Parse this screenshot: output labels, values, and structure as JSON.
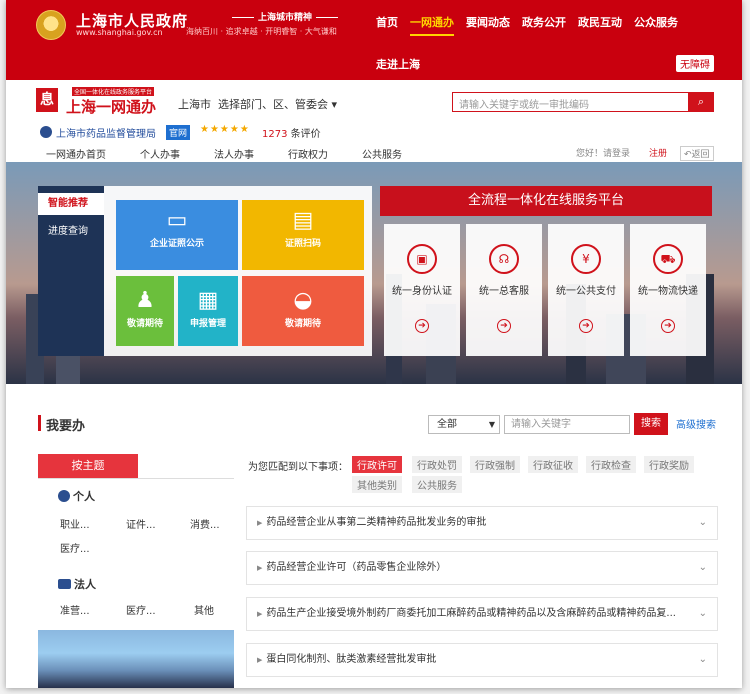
{
  "gov": {
    "title": "上海市人民政府",
    "url": "www.shanghai.gov.cn",
    "slogan_top": "上海城市精神",
    "slogan": "海纳百川 · 追求卓越 · 开明睿智 · 大气谦和",
    "nav": [
      "首页",
      "一网通办",
      "要闻动态",
      "政务公开",
      "政民互动",
      "公众服务"
    ],
    "nav_active": "一网通办",
    "nav2": "走进上海",
    "accessibility": "无障碍"
  },
  "ywtb": {
    "logo_mark": "息",
    "sub": "全国一体化在线政务服务平台",
    "title": "上海一网通办",
    "city": "上海市",
    "dept_select": "选择部门、区、管委会",
    "search_placeholder": "请输入关键字或统一审批编码",
    "agency": "上海市药品监督管理局",
    "official": "官网",
    "stars": "★★★★★",
    "rating_count": "1273",
    "rating_suffix": "条评价",
    "nav": [
      "一网通办首页",
      "个人办事",
      "法人办事",
      "行政权力",
      "公共服务"
    ],
    "login": "您好！请登录",
    "register": "注册",
    "back": "返回"
  },
  "banner": {
    "tab_active": "智能推荐",
    "tab_other": "进度查询",
    "tiles": [
      "企业证照公示",
      "证照扫码",
      "敬请期待",
      "申报管理",
      "敬请期待"
    ],
    "platform_title": "全流程一体化在线服务平台",
    "cards": [
      "统一身份认证",
      "统一总客服",
      "统一公共支付",
      "统一物流快递"
    ]
  },
  "wyb": {
    "title": "我要办",
    "scope": "全部",
    "keyword_placeholder": "请输入关键字",
    "search": "搜索",
    "advanced": "高级搜索",
    "by_theme": "按主题",
    "group_person": "个人",
    "person_items": [
      "职业...",
      "证件...",
      "消费...",
      "医疗..."
    ],
    "group_legal": "法人",
    "legal_items": [
      "准营...",
      "医疗...",
      "其他"
    ],
    "match_label": "为您匹配到以下事项：",
    "chips": [
      "行政许可",
      "行政处罚",
      "行政强制",
      "行政征收",
      "行政检查",
      "行政奖励",
      "其他类别",
      "公共服务"
    ],
    "chip_active": "行政许可",
    "items": [
      "药品经营企业从事第二类精神药品批发业务的审批",
      "药品经营企业许可（药品零售企业除外）",
      "药品生产企业接受境外制药厂商委托加工麻醉药品或精神药品以及含麻醉药品或精神药品复...",
      "蛋白同化制剂、肽类激素经营批发审批"
    ]
  },
  "colors": {
    "brand_red": "#c9000e",
    "accent_red": "#d0121b",
    "link_blue": "#1e6fd0"
  }
}
